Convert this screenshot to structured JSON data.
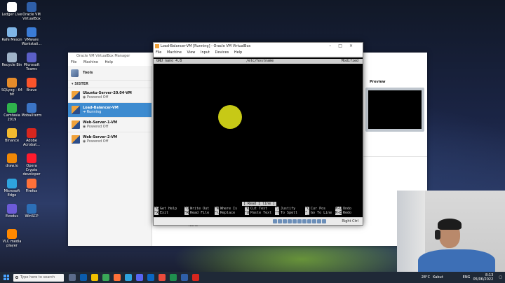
{
  "desktop_icons": [
    {
      "label": "Ledger Live",
      "color": "#ffffff"
    },
    {
      "label": "Oracle VM VirtualBox",
      "color": "#2f5fa8"
    },
    {
      "label": "Rafe Meson",
      "color": "#7fb5e6"
    },
    {
      "label": "VMware Workstati...",
      "color": "#3a7bd5"
    },
    {
      "label": "Recycle Bin",
      "color": "#9fb3c8"
    },
    {
      "label": "Microsoft Teams",
      "color": "#5b5fc7"
    },
    {
      "label": "SQLyog - 64 bit",
      "color": "#e58b2a"
    },
    {
      "label": "Brave",
      "color": "#fb542b"
    },
    {
      "label": "Camtasia 2019",
      "color": "#2fb34c"
    },
    {
      "label": "MobaXterm",
      "color": "#3b74c5"
    },
    {
      "label": "Binance",
      "color": "#f3ba2f"
    },
    {
      "label": "Adobe Acrobat...",
      "color": "#d7261e"
    },
    {
      "label": "draw.io",
      "color": "#f08705"
    },
    {
      "label": "Opera Crypto developer",
      "color": "#ff1b2d"
    },
    {
      "label": "Microsoft Edge",
      "color": "#2ea3de"
    },
    {
      "label": "Firefox",
      "color": "#ff7139"
    },
    {
      "label": "Exodus",
      "color": "#6c5bd8"
    },
    {
      "label": "WinSCP",
      "color": "#2c6fb7"
    },
    {
      "label": "VLC media player",
      "color": "#ff8800"
    }
  ],
  "manager": {
    "title": "Oracle VM VirtualBox Manager",
    "menu": [
      "File",
      "Machine",
      "Help"
    ],
    "tools_label": "Tools",
    "group_label": "SISTER",
    "vms": [
      {
        "name": "Ubuntu-Server-20.04-VM",
        "state": "Powered Off"
      },
      {
        "name": "Load-Balancer-VM",
        "state": "Running"
      },
      {
        "name": "Web-Server-1-VM",
        "state": "Powered Off"
      },
      {
        "name": "Web-Server-2-VM",
        "state": "Powered Off"
      }
    ],
    "preview_label": "Preview",
    "bottom_text": "None"
  },
  "vm_window": {
    "title": "Load-Balancer-VM [Running] - Oracle VM VirtualBox",
    "menu": [
      "File",
      "Machine",
      "View",
      "Input",
      "Devices",
      "Help"
    ],
    "nano": {
      "version": "GNU nano 4.8",
      "filename": "/etc/hostname",
      "modified": "Modified",
      "status_message": "[ Read 1 line ]",
      "shortcuts": [
        {
          "key": "^G",
          "label": "Get Help"
        },
        {
          "key": "^O",
          "label": "Write Out"
        },
        {
          "key": "^W",
          "label": "Where Is"
        },
        {
          "key": "^K",
          "label": "Cut Text"
        },
        {
          "key": "^J",
          "label": "Justify"
        },
        {
          "key": "^C",
          "label": "Cur Pos"
        },
        {
          "key": "M-U",
          "label": "Undo"
        },
        {
          "key": "^X",
          "label": "Exit"
        },
        {
          "key": "^R",
          "label": "Read File"
        },
        {
          "key": "^\\",
          "label": "Replace"
        },
        {
          "key": "^U",
          "label": "Paste Text"
        },
        {
          "key": "^T",
          "label": "To Spell"
        },
        {
          "key": "^_",
          "label": "Go To Line"
        },
        {
          "key": "M-E",
          "label": "Redo"
        }
      ]
    },
    "host_key": "Right Ctrl"
  },
  "taskbar": {
    "search_placeholder": "Type here to search",
    "temperature": "28°C",
    "weather": "Kabut",
    "time": "8:13",
    "date": "05/06/2022",
    "language": "ENG"
  }
}
